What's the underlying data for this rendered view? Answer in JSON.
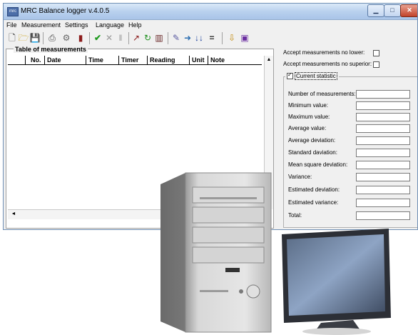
{
  "window": {
    "title": "MRC Balance logger v.4.0.5"
  },
  "menu": [
    "File",
    "Measurement",
    "Settings",
    "Language",
    "Help"
  ],
  "toolbar_icons": [
    "new-file-icon",
    "open-folder-icon",
    "save-icon",
    "print-icon",
    "settings-icon",
    "export-icon",
    "check-icon",
    "cancel-icon",
    "pause-icon",
    "graph-icon",
    "refresh-icon",
    "chart-icon",
    "tools-icon",
    "forward-icon",
    "sort-icon",
    "equals-icon",
    "import-icon",
    "info-icon"
  ],
  "table": {
    "caption": "Table of measurements",
    "headers": [
      "No.",
      "Date",
      "Time",
      "Timer",
      "Reading",
      "Unit",
      "Note"
    ]
  },
  "right_panel": {
    "accept_lower": "Accept measurements no lower:",
    "accept_superior": "Accept measurements no superior:",
    "current_statistic": "Current statistic",
    "stats": [
      "Number of measurements:",
      "Minimum value:",
      "Maximum value:",
      "Average value:",
      "Average deviation:",
      "Standard daviation:",
      "Mean square deviation:",
      "Variance:",
      "Estimated deviation:",
      "Estimated variance:",
      "Total:"
    ]
  },
  "scroll": {
    "up": "▲",
    "left": "◄"
  },
  "colors": {
    "title_grad_top": "#dbe9f8",
    "close_red": "#c1432a",
    "window_bg": "#f0f0f0"
  }
}
